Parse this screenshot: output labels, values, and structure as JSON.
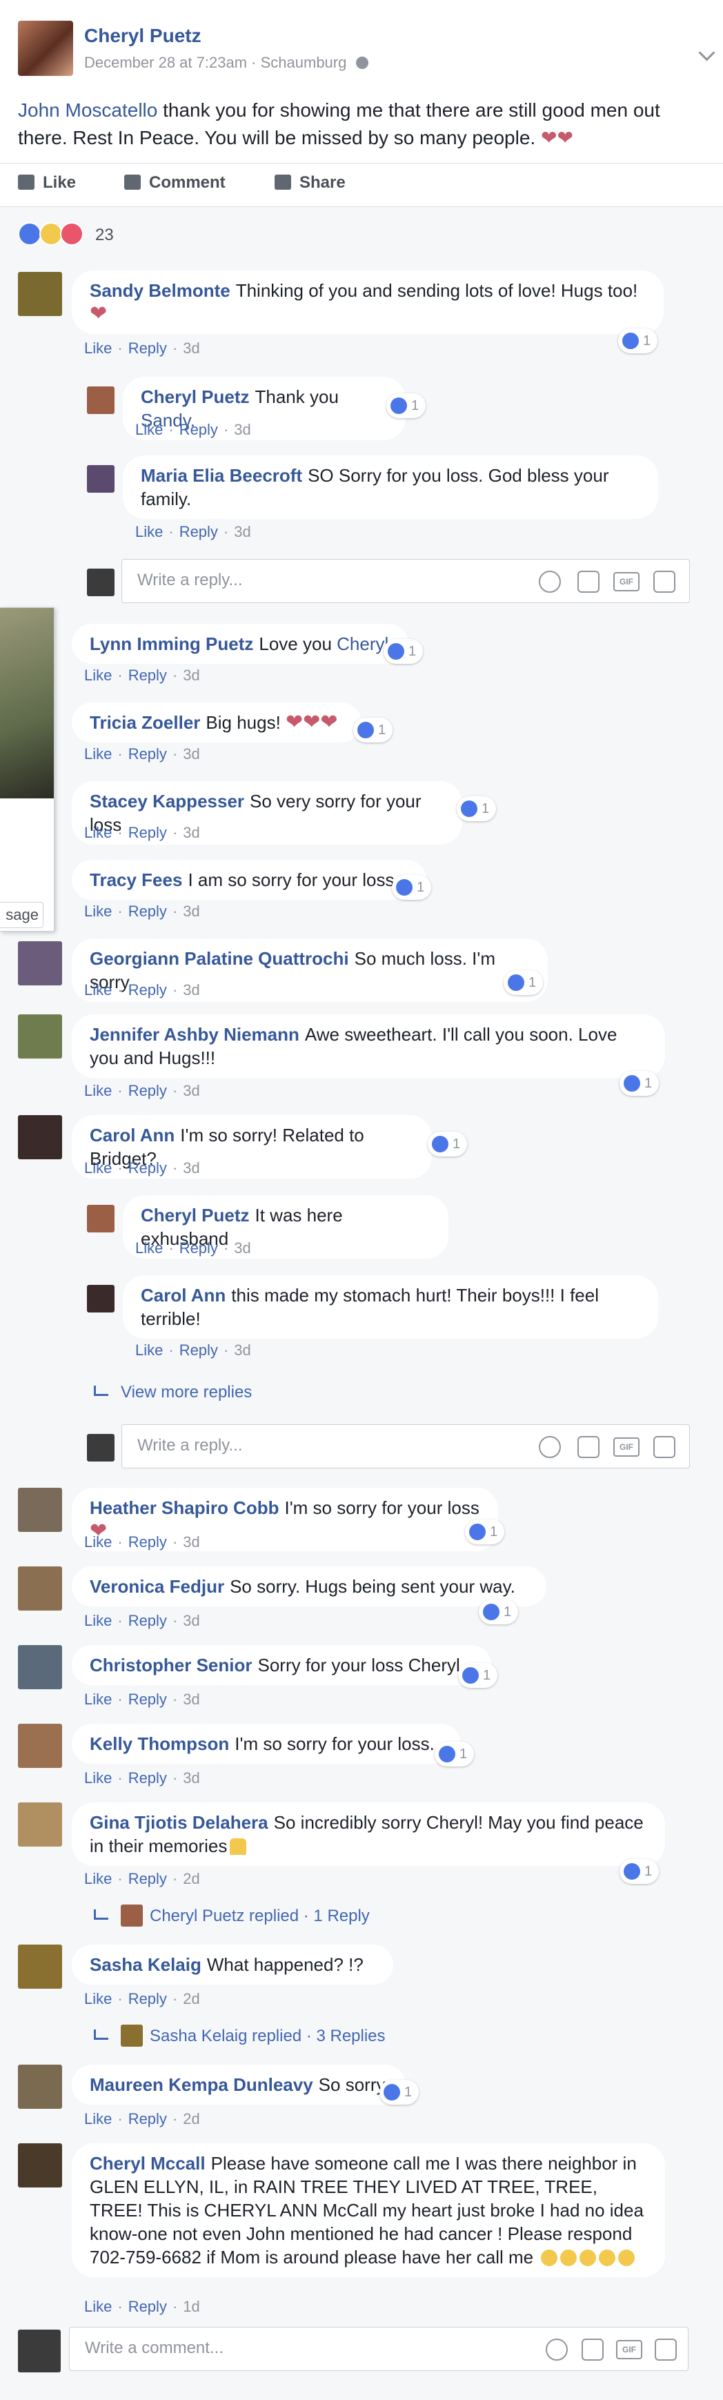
{
  "post": {
    "author": "Cheryl Puetz",
    "date": "December 28 at 7:23am",
    "location": "Schaumburg",
    "mention": "John Moscatello",
    "text": " thank you for showing me that there are still good men out there. Rest In Peace. You will be missed by so many people.",
    "hearts": "❤❤",
    "actions": {
      "like": "Like",
      "comment": "Comment",
      "share": "Share"
    },
    "reaction_count": "23"
  },
  "labels": {
    "like": "Like",
    "reply": "Reply",
    "write_reply": "Write a reply...",
    "view_more": "View more replies",
    "write_comment": "Write a comment...",
    "gif": "GIF"
  },
  "comments": [
    {
      "name": "Sandy Belmonte",
      "text": "Thinking of you and sending lots of love! Hugs too!",
      "time": "3d",
      "likes": "1"
    },
    {
      "name": "Cheryl Puetz",
      "text": "Thank you ",
      "link": "Sandy.",
      "time": "3d",
      "likes": "1"
    },
    {
      "name": "Maria Elia Beecroft",
      "text": "SO Sorry for you loss. God bless your family.",
      "time": "3d"
    },
    {
      "name": "Lynn Imming Puetz",
      "text": "Love you ",
      "link": "Cheryl",
      "time": "3d",
      "likes": "1"
    },
    {
      "name": "Tricia Zoeller",
      "text": "Big hugs! ",
      "time": "3d",
      "likes": "1"
    },
    {
      "name": "Stacey Kappesser",
      "text": "So very sorry for your loss",
      "time": "3d",
      "likes": "1"
    },
    {
      "name": "Tracy Fees",
      "text": "I am so sorry for your loss.",
      "time": "3d",
      "likes": "1"
    },
    {
      "name": "Georgiann Palatine Quattrochi",
      "text": "So much loss. I'm sorry",
      "time": "3d",
      "likes": "1"
    },
    {
      "name": "Jennifer Ashby Niemann",
      "text": "Awe sweetheart. I'll call you soon. Love you and Hugs!!!",
      "time": "3d",
      "likes": "1"
    },
    {
      "name": "Carol Ann",
      "text": "I'm so sorry! Related to Bridget?",
      "time": "3d",
      "likes": "1"
    },
    {
      "name": "Cheryl Puetz",
      "text": "It was here exhusband",
      "time": "3d"
    },
    {
      "name": "Carol Ann",
      "text": "this made my stomach hurt! Their boys!!! I feel terrible!",
      "time": "3d"
    },
    {
      "name": "Heather Shapiro Cobb",
      "text": "I'm so sorry for your loss",
      "time": "3d",
      "likes": "1"
    },
    {
      "name": "Veronica Fedjur",
      "text": "So sorry. Hugs being sent your way.",
      "time": "3d",
      "likes": "1"
    },
    {
      "name": "Christopher Senior",
      "text": "Sorry for your loss Cheryl",
      "time": "3d",
      "likes": "1"
    },
    {
      "name": "Kelly Thompson",
      "text": "I'm so sorry for your loss.",
      "time": "3d",
      "likes": "1"
    },
    {
      "name": "Gina Tjiotis Delahera",
      "text": "So incredibly sorry Cheryl! May you find peace in their memories",
      "time": "2d",
      "likes": "1",
      "replied": "Cheryl Puetz replied · 1 Reply"
    },
    {
      "name": "Sasha Kelaig",
      "text": "What happened? !?",
      "time": "2d",
      "replied": "Sasha Kelaig replied · 3 Replies"
    },
    {
      "name": "Maureen Kempa Dunleavy",
      "text": "So sorry",
      "time": "2d",
      "likes": "1"
    },
    {
      "name": "Cheryl Mccall",
      "text": "Please have someone call me I was there neighbor in GLEN ELLYN, IL, in RAIN TREE THEY LIVED AT TREE, TREE, TREE! This is CHERYL ANN McCall my heart just broke I had no idea know-one not even John mentioned he had cancer ! Please respond 702-759-6682 if Mom is around please have her call me",
      "time": "1d"
    }
  ],
  "popup": {
    "button": "sage"
  }
}
